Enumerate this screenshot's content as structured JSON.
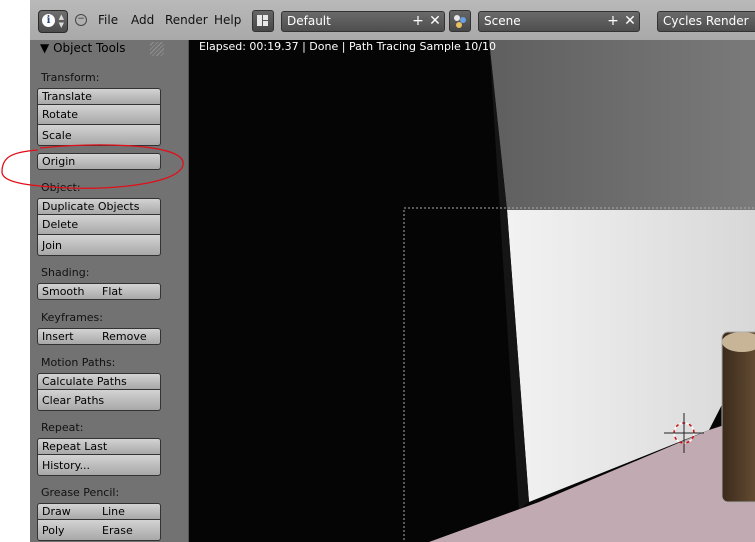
{
  "header": {
    "menus": [
      "File",
      "Add",
      "Render",
      "Help"
    ],
    "layout_name": "Default",
    "scene_name": "Scene",
    "render_engine": "Cycles Render",
    "icons": {
      "editor_type": "info-icon",
      "layout": "screen-layout-icon",
      "scene": "scene-icon",
      "add": "plus-icon",
      "remove": "x-icon"
    }
  },
  "toolshelf": {
    "title": "Object Tools",
    "sections": {
      "transform": {
        "label": "Transform:",
        "buttons": [
          "Translate",
          "Rotate",
          "Scale",
          "Origin"
        ]
      },
      "object": {
        "label": "Object:",
        "buttons": [
          "Duplicate Objects",
          "Delete",
          "Join"
        ]
      },
      "shading": {
        "label": "Shading:",
        "buttons": [
          "Smooth",
          "Flat"
        ]
      },
      "keyframes": {
        "label": "Keyframes:",
        "buttons": [
          "Insert",
          "Remove"
        ]
      },
      "motion_paths": {
        "label": "Motion Paths:",
        "buttons": [
          "Calculate Paths",
          "Clear Paths"
        ]
      },
      "repeat": {
        "label": "Repeat:",
        "buttons": [
          "Repeat Last",
          "History..."
        ]
      },
      "grease_pencil": {
        "label": "Grease Pencil:",
        "buttons": [
          "Draw",
          "Line",
          "Poly",
          "Erase"
        ]
      }
    }
  },
  "viewport": {
    "status": "Elapsed: 00:19.37 | Done | Path Tracing Sample 10/10"
  },
  "colors": {
    "annotation_circle": "#e0101a",
    "floor": "#c2aab2",
    "background_panel": "#727272"
  }
}
